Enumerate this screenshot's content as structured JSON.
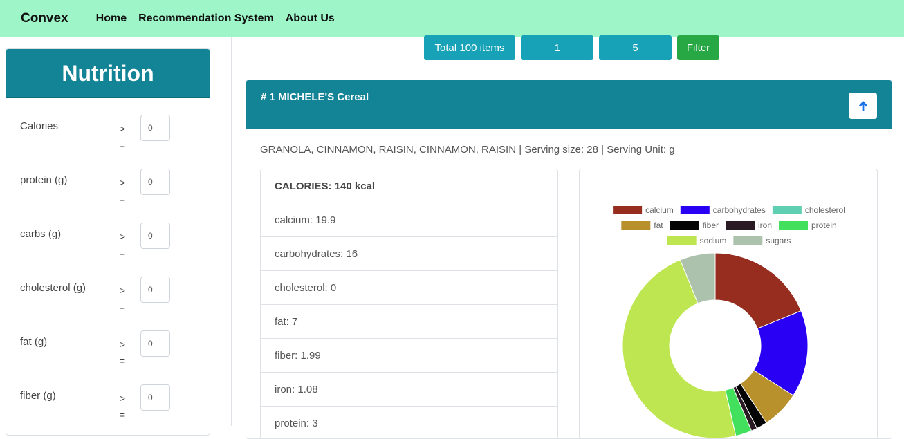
{
  "navbar": {
    "brand": "Convex",
    "links": [
      "Home",
      "Recommendation System",
      "About Us"
    ]
  },
  "sidebar": {
    "title": "Nutrition",
    "filters": [
      {
        "label": "Calories",
        "op_top": ">",
        "op_bottom": "="
      },
      {
        "label": "protein (g)",
        "op_top": ">",
        "op_bottom": "="
      },
      {
        "label": "carbs (g)",
        "op_top": ">",
        "op_bottom": "="
      },
      {
        "label": "cholesterol (g)",
        "op_top": ">",
        "op_bottom": "="
      },
      {
        "label": "fat (g)",
        "op_top": ">",
        "op_bottom": "="
      },
      {
        "label": "fiber (g)",
        "op_top": ">",
        "op_bottom": "="
      }
    ],
    "input_value": "0"
  },
  "toolbar": {
    "total": "Total 100 items",
    "page": "1",
    "page_size": "5",
    "filter_label": "Filter"
  },
  "card": {
    "title": "# 1 MICHELE'S Cereal",
    "description": "GRANOLA, CINNAMON, RAISIN, CINNAMON, RAISIN | Serving size: 28 | Serving Unit: g",
    "nutrients": [
      "CALORIES: 140 kcal",
      "calcium: 19.9",
      "carbohydrates: 16",
      "cholesterol: 0",
      "fat: 7",
      "fiber: 1.99",
      "iron: 1.08",
      "protein: 3"
    ]
  },
  "colors": {
    "navbar": "#9df5c8",
    "header": "#138496",
    "info": "#17a2b8",
    "success": "#28a745"
  },
  "chart_data": {
    "type": "pie",
    "donut": true,
    "legend_position": "top",
    "series": [
      {
        "name": "calcium",
        "value": 19.9,
        "color": "#962d1f"
      },
      {
        "name": "carbohydrates",
        "value": 16,
        "color": "#2a00f5"
      },
      {
        "name": "cholesterol",
        "value": 0,
        "color": "#5ed0b1"
      },
      {
        "name": "fat",
        "value": 7,
        "color": "#b8902c"
      },
      {
        "name": "fiber",
        "value": 1.99,
        "color": "#050505"
      },
      {
        "name": "iron",
        "value": 1.08,
        "color": "#2a1a24"
      },
      {
        "name": "protein",
        "value": 3,
        "color": "#43e05e"
      },
      {
        "name": "sodium",
        "value": 50,
        "color": "#bde651"
      },
      {
        "name": "sugars",
        "value": 6.5,
        "color": "#adc2ad"
      }
    ]
  }
}
